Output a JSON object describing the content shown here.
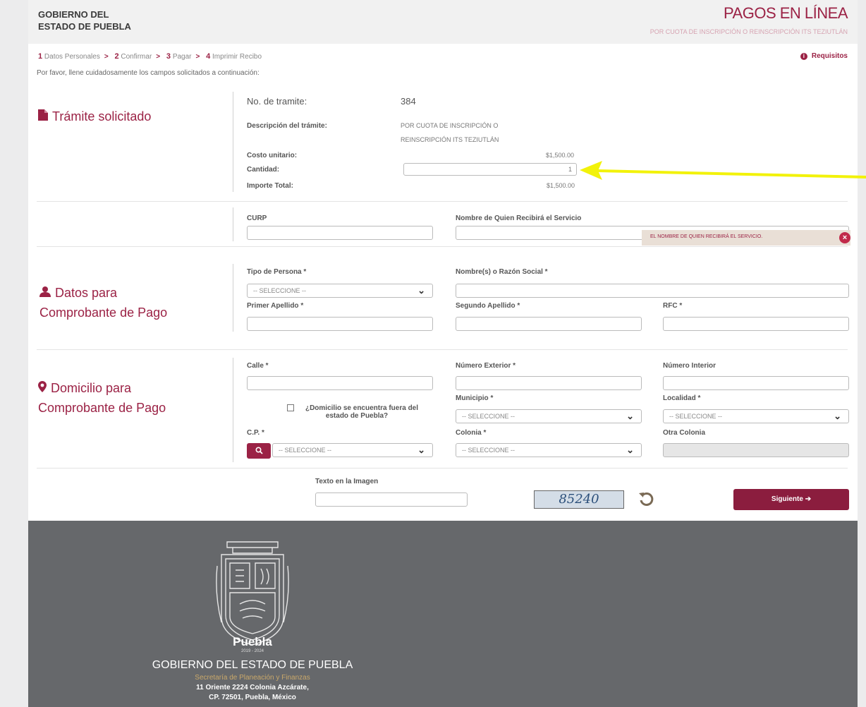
{
  "header": {
    "gov_line1": "GOBIERNO DEL",
    "gov_line2": "ESTADO DE PUEBLA",
    "title": "PAGOS EN LÍNEA",
    "subtitle": "POR CUOTA DE INSCRIPCIÓN O REINSCRIPCIÓN ITS TEZIUTLÁN"
  },
  "steps": [
    {
      "num": "1",
      "label": "Datos Personales"
    },
    {
      "num": "2",
      "label": "Confirmar"
    },
    {
      "num": "3",
      "label": "Pagar"
    },
    {
      "num": "4",
      "label": "Imprimir Recibo"
    }
  ],
  "requirements_label": "Requisitos",
  "instructions": "Por favor, llene cuidadosamente los campos solicitados a continuación:",
  "tramite": {
    "section_title": "Trámite solicitado",
    "no_label": "No. de tramite:",
    "no_value": "384",
    "desc_label": "Descripción del trámite:",
    "desc_line1": "POR CUOTA DE INSCRIPCIÓN O",
    "desc_line2": "REINSCRIPCIÓN ITS TEZIUTLÁN",
    "cost_label": "Costo unitario:",
    "cost_value": "$1,500.00",
    "qty_label": "Cantidad:",
    "qty_value": "1",
    "total_label": "Importe Total:",
    "total_value": "$1,500.00"
  },
  "recipient": {
    "curp_label": "CURP",
    "name_label": "Nombre de Quien Recibirá el Servicio",
    "tooltip": "EL NOMBRE DE QUIEN RECIBIRÁ EL SERVICIO."
  },
  "datos": {
    "section_line1": "Datos para",
    "section_line2": "Comprobante de Pago",
    "tipo_label": "Tipo de Persona *",
    "tipo_value": "-- SELECCIONE --",
    "nombre_label": "Nombre(s) o Razón Social *",
    "primer_label": "Primer Apellido *",
    "segundo_label": "Segundo Apellido *",
    "rfc_label": "RFC *"
  },
  "domicilio": {
    "section_line1": "Domicilio para",
    "section_line2": "Comprobante de Pago",
    "calle_label": "Calle *",
    "num_ext_label": "Número Exterior *",
    "num_int_label": "Número Interior",
    "municipio_label": "Municipio *",
    "municipio_value": "-- SELECCIONE --",
    "localidad_label": "Localidad *",
    "localidad_value": "-- SELECCIONE --",
    "fuera_line1": "¿Domicilio se encuentra fuera del",
    "fuera_line2": "estado de Puebla?",
    "cp_label": "C.P. *",
    "cp_value": "-- SELECCIONE --",
    "colonia_label": "Colonia *",
    "colonia_value": "-- SELECCIONE --",
    "otra_label": "Otra Colonia"
  },
  "captcha": {
    "label": "Texto en la Imagen",
    "image_text": "85240"
  },
  "next_button": "Siguiente",
  "footer": {
    "brand": "Puebla",
    "years": "2019 - 2024",
    "gov": "GOBIERNO DEL ESTADO DE PUEBLA",
    "secretaria": "Secretaría de Planeación y Finanzas",
    "addr1": "11 Oriente 2224 Colonia Azcárate,",
    "addr2": "CP. 72501, Puebla, México"
  },
  "icons": {
    "file": "file-icon",
    "user": "user-icon",
    "map_marker": "map-marker-icon",
    "search": "search-icon",
    "refresh": "refresh-icon",
    "arrow_right": "arrow-right-icon",
    "info": "info-icon",
    "close": "close-icon",
    "chevron_down": "chevron-down-icon"
  },
  "colors": {
    "brand": "#9b2245",
    "button": "#8b1d3e",
    "footer": "#66686b",
    "annotation_arrow": "#f2f20a"
  }
}
